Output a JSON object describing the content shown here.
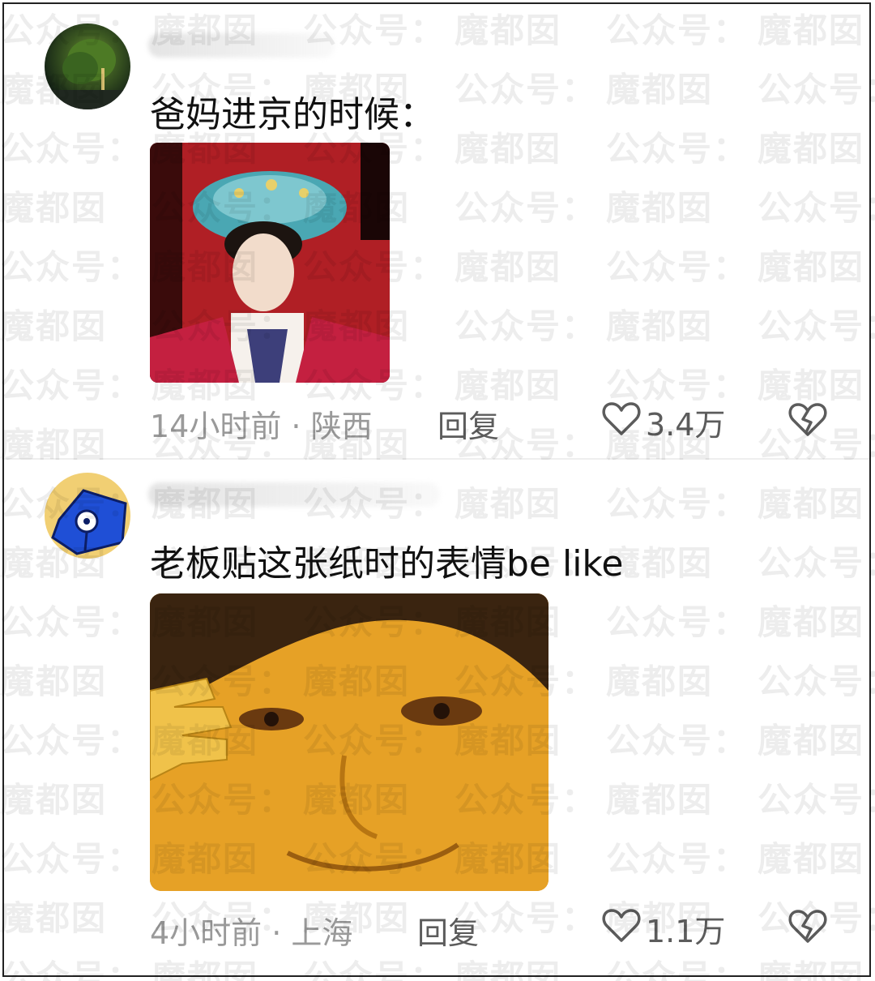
{
  "comments": [
    {
      "text": "爸妈进京的时候：",
      "meta": "14小时前 · 陕西",
      "reply_label": "回复",
      "like_count": "3.4万"
    },
    {
      "text": "老板贴这张纸时的表情be like",
      "meta": "4小时前 · 上海",
      "reply_label": "回复",
      "like_count": "1.1万"
    }
  ],
  "watermark": {
    "text_a": "公众号：",
    "text_b": "魔都囡"
  },
  "icons": {
    "like": "heart-outline-icon",
    "dislike": "broken-heart-icon"
  },
  "colors": {
    "text_primary": "#111111",
    "text_meta": "#9a9a9a",
    "text_action": "#5c5c5c"
  }
}
